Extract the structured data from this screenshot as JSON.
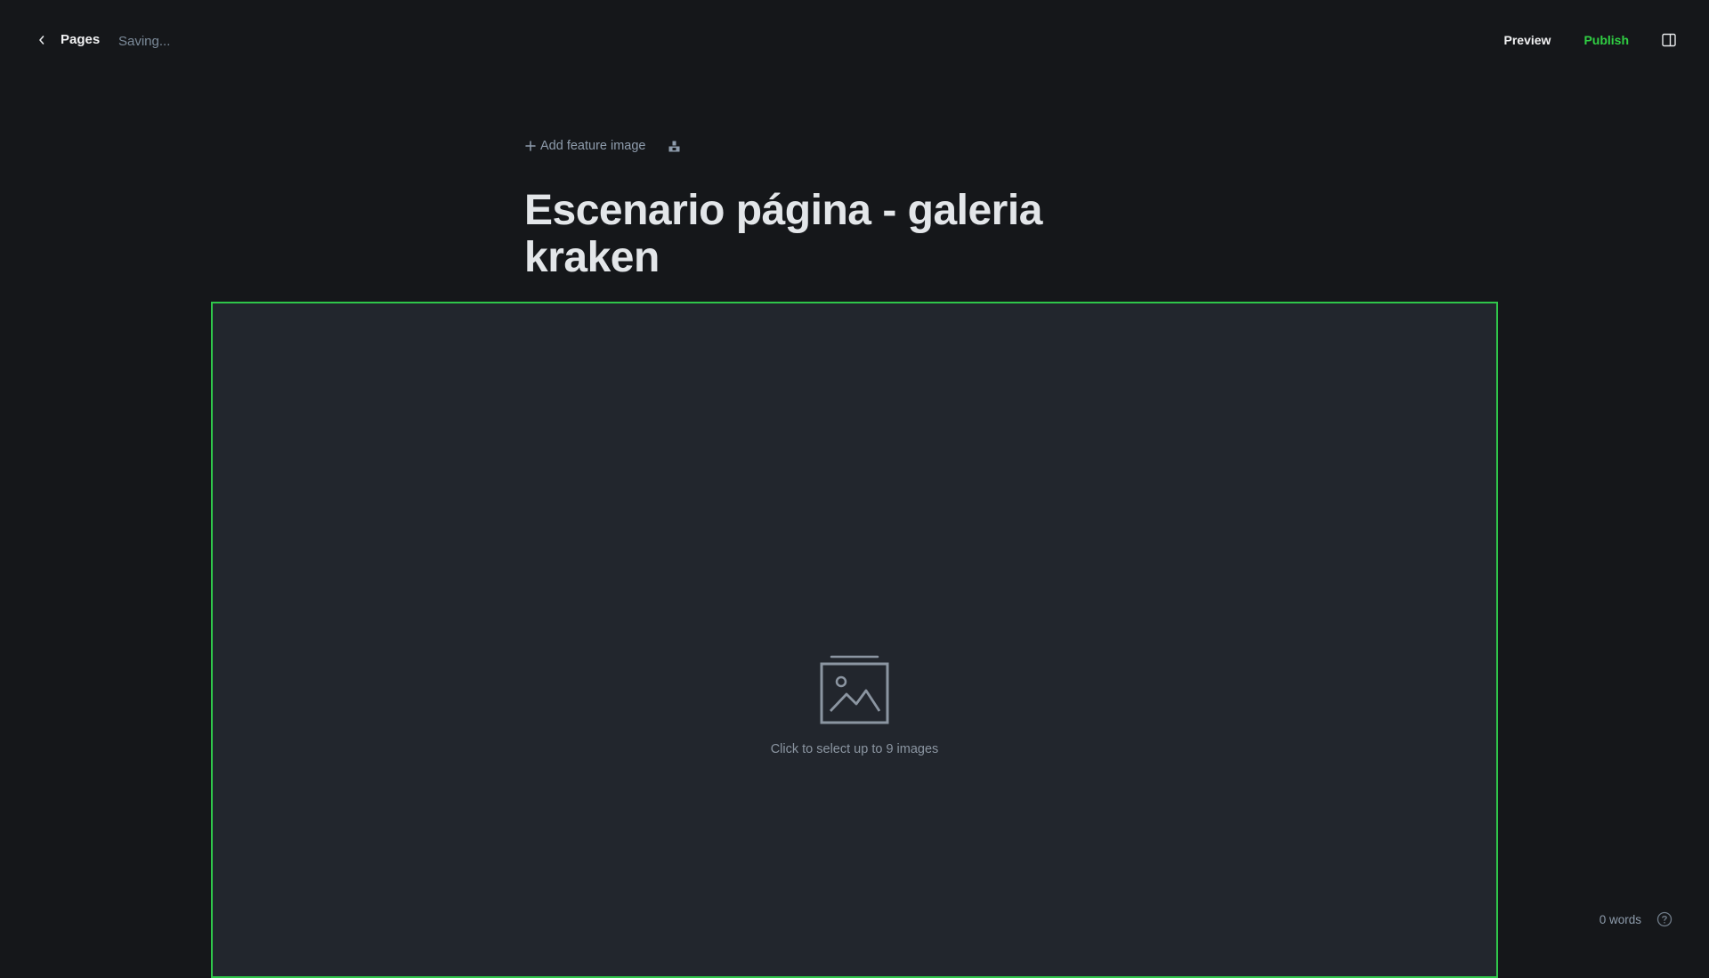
{
  "header": {
    "back_label": "Pages",
    "save_status": "Saving...",
    "preview_label": "Preview",
    "publish_label": "Publish",
    "icons": {
      "back": "chevron-left-icon",
      "sidebar": "sidebar-toggle-icon"
    }
  },
  "editor": {
    "feature_image_label": "Add feature image",
    "title": "Escenario página - galeria kraken",
    "icons": {
      "add": "plus-icon",
      "snippet": "snippet-icon"
    }
  },
  "gallery": {
    "hint": "Click to select up to 9 images",
    "icon": "image-gallery-icon"
  },
  "footer": {
    "word_count": "0 words",
    "help_icon": "help-circle-icon"
  },
  "colors": {
    "background": "#15171a",
    "accent": "#30cf43",
    "gallery_bg": "#22262d",
    "muted_text": "#8e9cac"
  }
}
